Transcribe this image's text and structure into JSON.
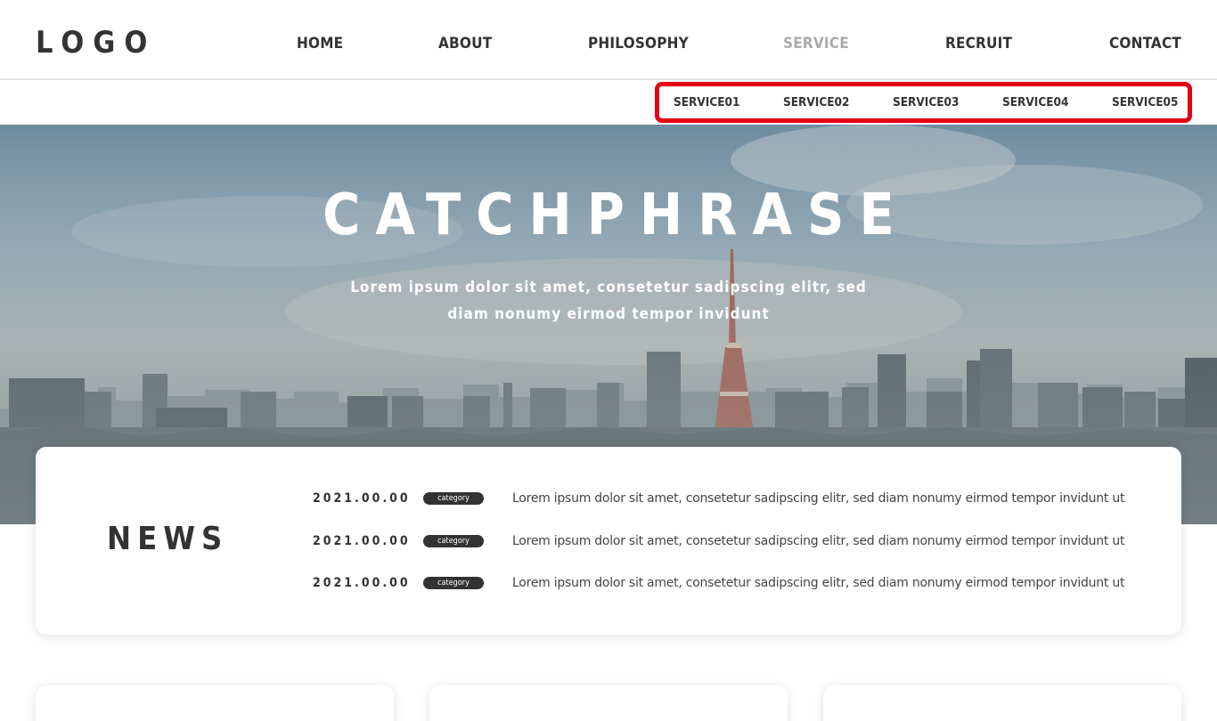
{
  "header": {
    "logo": "LOGO",
    "nav": [
      {
        "label": "HOME"
      },
      {
        "label": "ABOUT"
      },
      {
        "label": "PHILOSOPHY"
      },
      {
        "label": "SERVICE",
        "active": true
      },
      {
        "label": "RECRUIT"
      },
      {
        "label": "CONTACT"
      }
    ]
  },
  "subnav": {
    "items": [
      {
        "label": "SERVICE01"
      },
      {
        "label": "SERVICE02"
      },
      {
        "label": "SERVICE03"
      },
      {
        "label": "SERVICE04"
      },
      {
        "label": "SERVICE05"
      }
    ],
    "highlight_color": "#e60012"
  },
  "hero": {
    "catchphrase": "CATCHPHRASE",
    "lead": "Lorem ipsum dolor sit amet, consetetur sadipscing elitr, sed diam nonumy eirmod tempor invidunt"
  },
  "news": {
    "title": "NEWS",
    "items": [
      {
        "date": "2021.00.00",
        "category": "category",
        "text": "Lorem ipsum dolor sit amet, consetetur sadipscing elitr, sed diam nonumy eirmod tempor invidunt ut"
      },
      {
        "date": "2021.00.00",
        "category": "category",
        "text": "Lorem ipsum dolor sit amet, consetetur sadipscing elitr, sed diam nonumy eirmod tempor invidunt ut"
      },
      {
        "date": "2021.00.00",
        "category": "category",
        "text": "Lorem ipsum dolor sit amet, consetetur sadipscing elitr, sed diam nonumy eirmod tempor invidunt ut"
      }
    ]
  },
  "colors": {
    "text": "#333333",
    "active_nav": "#aaaaaa",
    "badge": "#333333"
  }
}
